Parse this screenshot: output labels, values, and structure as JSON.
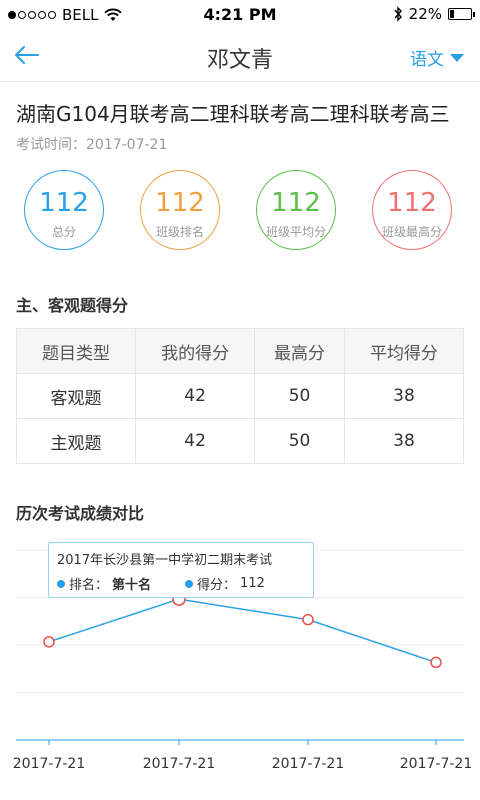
{
  "status": {
    "carrier": "BELL",
    "time": "4:21 PM",
    "battery_text": "22%",
    "battery_level": 0.22
  },
  "nav": {
    "title": "邓文青",
    "subject": "语文"
  },
  "exam": {
    "title": "湖南G104月联考高二理科联考高二理科联考高三",
    "time": "考试时间：2017-07-21"
  },
  "scores": [
    {
      "value": "112",
      "label": "总分",
      "color": "#2aa0e8"
    },
    {
      "value": "112",
      "label": "班级排名",
      "color": "#f0a040"
    },
    {
      "value": "112",
      "label": "班级平均分",
      "color": "#5ac04a"
    },
    {
      "value": "112",
      "label": "班级最高分",
      "color": "#f07070"
    }
  ],
  "section1": {
    "title": "主、客观题得分"
  },
  "table": {
    "headers": [
      "题目类型",
      "我的得分",
      "最高分",
      "平均得分"
    ],
    "rows": [
      [
        "客观题",
        "42",
        "50",
        "38"
      ],
      [
        "主观题",
        "42",
        "50",
        "38"
      ]
    ]
  },
  "section2": {
    "title": "历次考试成绩对比"
  },
  "tooltip": {
    "title": "2017年长沙县第一中学初二期末考试",
    "rank_label": "排名：",
    "rank_value": "第十名",
    "score_label": "得分：",
    "score_value": "112"
  },
  "chart_data": {
    "type": "line",
    "categories": [
      "2017-7-21",
      "2017-7-21",
      "2017-7-21",
      "2017-7-21"
    ],
    "values": [
      62,
      89,
      76,
      49
    ],
    "ylim": [
      0,
      120
    ],
    "grid": true,
    "line_color": "#2aa0e8",
    "marker_color": "#e85050",
    "highlighted_index": 1
  }
}
